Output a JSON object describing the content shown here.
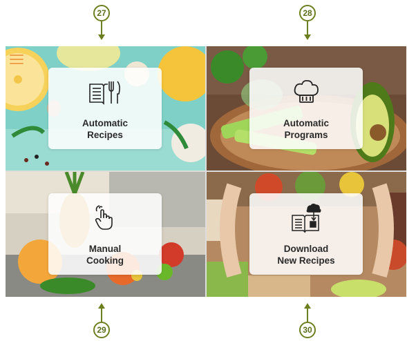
{
  "callouts": [
    {
      "number": "27",
      "target": "automatic-recipes"
    },
    {
      "number": "28",
      "target": "automatic-programs"
    },
    {
      "number": "29",
      "target": "manual-cooking"
    },
    {
      "number": "30",
      "target": "download-new-recipes"
    }
  ],
  "menu": {
    "icon": "hamburger-menu-icon",
    "color": "#f0a04b"
  },
  "tiles": [
    {
      "label": "Automatic\nRecipes",
      "icon": "recipe-book-cutlery-icon"
    },
    {
      "label": "Automatic\nPrograms",
      "icon": "chef-hat-icon"
    },
    {
      "label": "Manual\nCooking",
      "icon": "hand-tap-icon"
    },
    {
      "label": "Download\nNew Recipes",
      "icon": "book-cloud-download-icon"
    }
  ],
  "colors": {
    "callout": "#6b7f1f",
    "card_text": "#2a2a2a"
  }
}
